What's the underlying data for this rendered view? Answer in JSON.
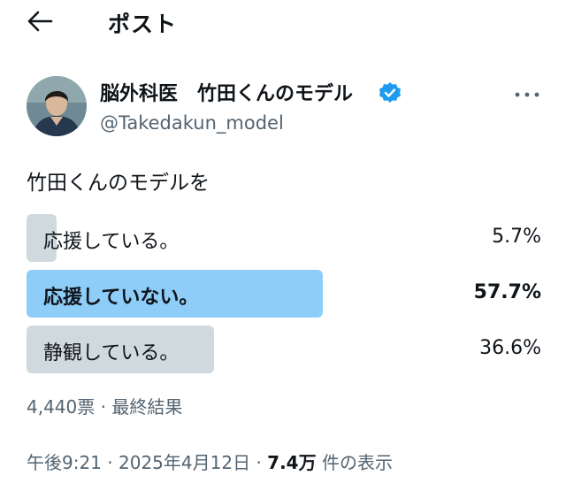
{
  "header": {
    "title": "ポスト",
    "back_icon": "arrow-left-icon"
  },
  "author": {
    "name": "脳外科医　竹田くんのモデル",
    "handle": "@Takedakun_model",
    "verified_color": "#1d9bf0"
  },
  "post": {
    "text": "竹田くんのモデルを"
  },
  "poll": {
    "options": [
      {
        "label": "応援している。",
        "percent": 5.7,
        "percent_label": "5.7%",
        "winner": false
      },
      {
        "label": "応援していない。",
        "percent": 57.7,
        "percent_label": "57.7%",
        "winner": true
      },
      {
        "label": "静観している。",
        "percent": 36.6,
        "percent_label": "36.6%",
        "winner": false
      }
    ],
    "summary": "4,440票 · 最終結果",
    "bar_color": "#cfd9de",
    "winner_bar_color": "#8ecdf8"
  },
  "meta": {
    "time": "午後9:21",
    "separator": "·",
    "date": "2025年4月12日",
    "views_count": "7.4万",
    "views_label": "件の表示"
  }
}
